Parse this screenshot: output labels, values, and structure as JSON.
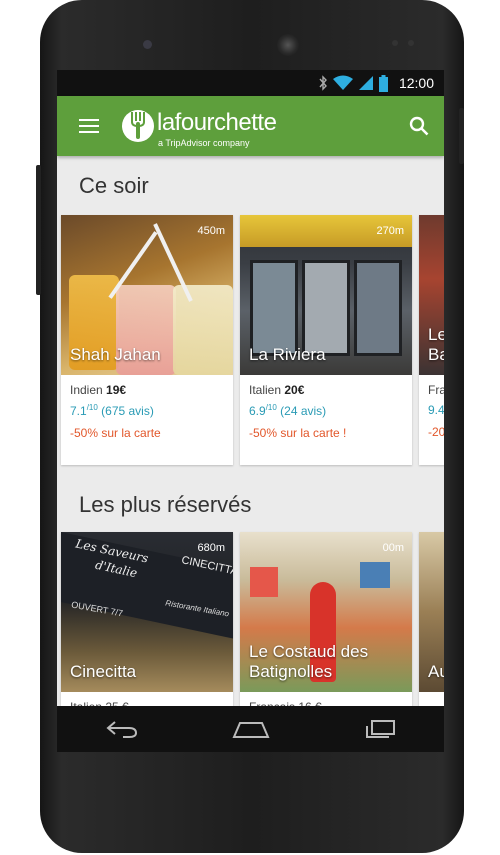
{
  "status_bar": {
    "time": "12:00"
  },
  "app_bar": {
    "brand": "lafourchette",
    "tagline": "a TripAdvisor company"
  },
  "sections": [
    {
      "title": "Ce soir",
      "cards": [
        {
          "name": "Shah Jahan",
          "distance": "450m",
          "cuisine": "Indien",
          "price": "19€",
          "rating": "7.1",
          "rating_scale": "/10",
          "reviews": "(675 avis)",
          "promo": "-50% sur la carte"
        },
        {
          "name": "La Riviera",
          "distance": "270m",
          "cuisine": "Italien",
          "price": "20€",
          "rating": "6.9",
          "rating_scale": "/10",
          "reviews": "(24 avis)",
          "promo": "-50% sur la carte !"
        },
        {
          "name": "Le Ba",
          "distance": "",
          "cuisine": "Fra",
          "price": "",
          "rating": "9.4",
          "rating_scale": "",
          "reviews": "",
          "promo": "-20"
        }
      ]
    },
    {
      "title": "Les plus réservés",
      "cards": [
        {
          "name": "Cinecitta",
          "distance": "680m",
          "sign_1": "Les Saveurs",
          "sign_2": "d'Italie",
          "sign_3": "CINECITTA",
          "sign_4": "OUVERT 7/7",
          "sign_5": "Ristorante Italiano",
          "peek": "Italien 25 €"
        },
        {
          "name": "Le Costaud des Batignolles",
          "distance": "00m",
          "peek": "Français 16 €"
        },
        {
          "name": "Au",
          "distance": "",
          "peek": ""
        }
      ]
    }
  ],
  "icons": {
    "menu": "menu-icon",
    "logo": "fork-logo-icon",
    "search": "search-icon",
    "back": "back-icon",
    "home": "home-icon",
    "recents": "recents-icon",
    "bluetooth": "bluetooth-icon",
    "wifi": "wifi-icon",
    "signal": "signal-icon",
    "battery": "battery-icon"
  },
  "colors": {
    "app_bar": "#5e9f3c",
    "rating": "#2a9bb5",
    "promo": "#e2572b"
  }
}
